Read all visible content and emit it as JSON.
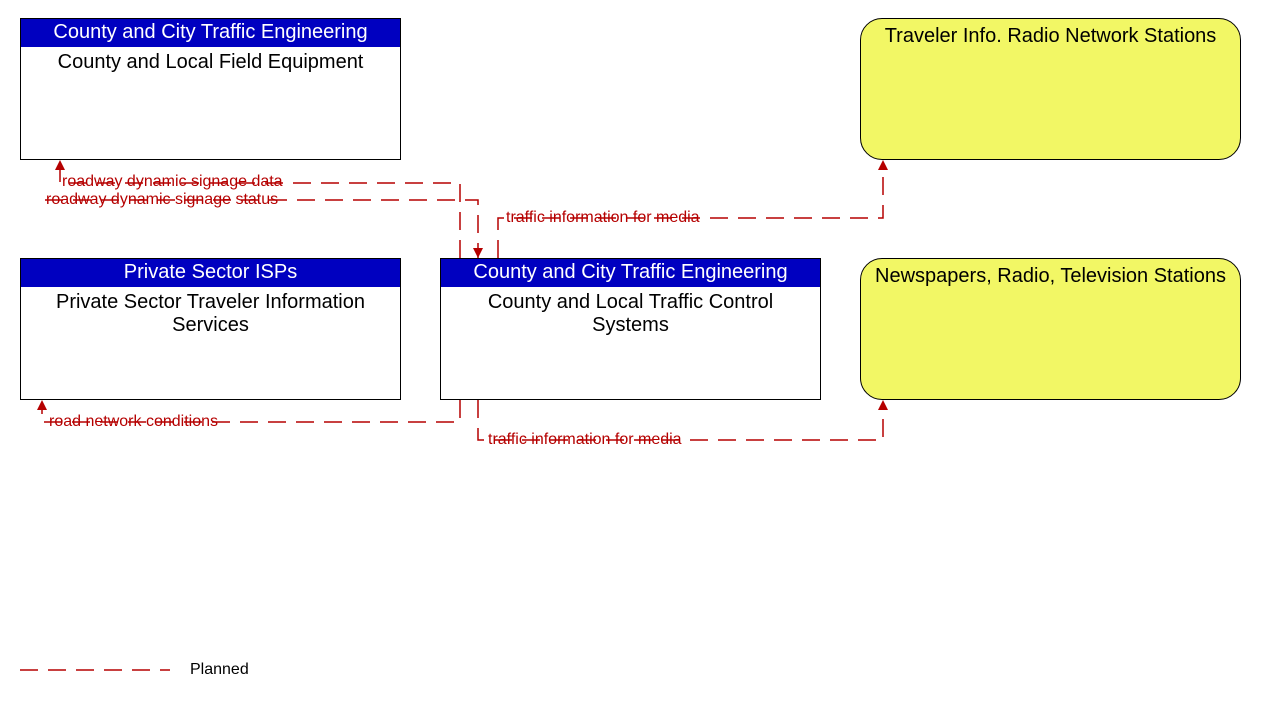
{
  "nodes": {
    "field_equipment": {
      "header": "County and City Traffic Engineering",
      "body": "County and Local Field Equipment"
    },
    "private_isp": {
      "header": "Private Sector ISPs",
      "body": "Private Sector Traveler Information Services"
    },
    "traffic_control": {
      "header": "County and City Traffic Engineering",
      "body": "County and Local Traffic Control Systems"
    },
    "radio_network": {
      "body": "Traveler Info. Radio Network Stations"
    },
    "newspapers": {
      "body": "Newspapers, Radio, Television Stations"
    }
  },
  "flows": {
    "signage_data": "roadway dynamic signage data",
    "signage_status": "roadway dynamic signage status",
    "traffic_media_top": "traffic information for media",
    "road_conditions": "road network conditions",
    "traffic_media_bottom": "traffic information for media"
  },
  "legend": {
    "planned": "Planned"
  },
  "chart_data": {
    "type": "diagram",
    "nodes": [
      {
        "id": "field_equipment",
        "stakeholder": "County and City Traffic Engineering",
        "element": "County and Local Field Equipment",
        "style": "white-box"
      },
      {
        "id": "private_isp",
        "stakeholder": "Private Sector ISPs",
        "element": "Private Sector Traveler Information Services",
        "style": "white-box"
      },
      {
        "id": "traffic_control",
        "stakeholder": "County and City Traffic Engineering",
        "element": "County and Local Traffic Control Systems",
        "style": "white-box"
      },
      {
        "id": "radio_network",
        "element": "Traveler Info. Radio Network Stations",
        "style": "yellow-rounded"
      },
      {
        "id": "newspapers",
        "element": "Newspapers, Radio, Television Stations",
        "style": "yellow-rounded"
      }
    ],
    "edges": [
      {
        "from": "traffic_control",
        "to": "field_equipment",
        "label": "roadway dynamic signage data",
        "status": "Planned"
      },
      {
        "from": "field_equipment",
        "to": "traffic_control",
        "label": "roadway dynamic signage status",
        "status": "Planned"
      },
      {
        "from": "traffic_control",
        "to": "radio_network",
        "label": "traffic information for media",
        "status": "Planned"
      },
      {
        "from": "traffic_control",
        "to": "private_isp",
        "label": "road network conditions",
        "status": "Planned"
      },
      {
        "from": "traffic_control",
        "to": "newspapers",
        "label": "traffic information for media",
        "status": "Planned"
      }
    ],
    "legend": [
      {
        "style": "dashed-red",
        "meaning": "Planned"
      }
    ]
  }
}
